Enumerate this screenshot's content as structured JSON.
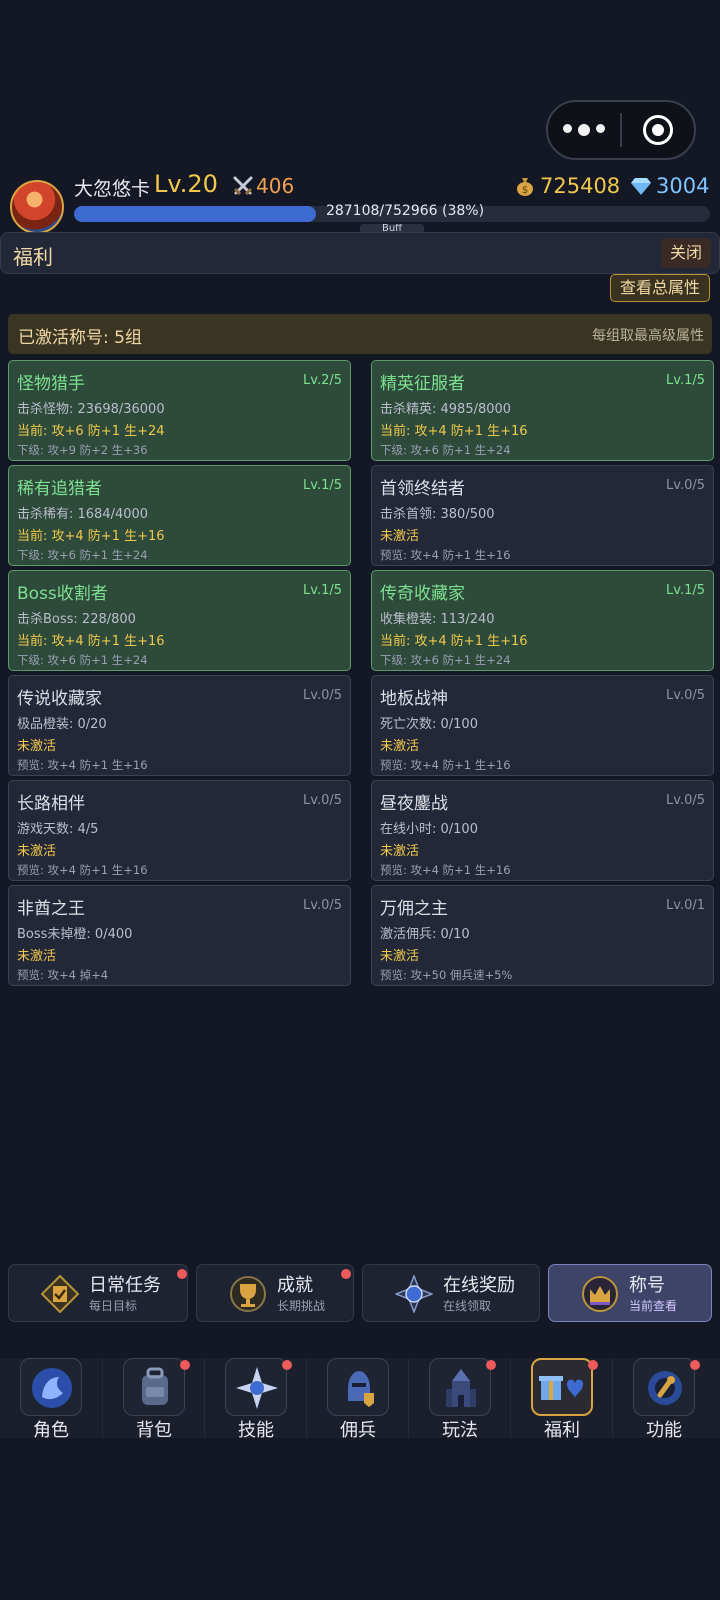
{
  "header": {
    "player_name": "大忽悠卡",
    "level": "Lv.20",
    "power": "406",
    "gold": "725408",
    "gems": "3004",
    "xp_text": "287108/752966 (38%)",
    "xp_progress": 0.38,
    "buff_label": "Buff"
  },
  "panel": {
    "title": "福利",
    "close_label": "关闭",
    "total_attr_label": "查看总属性",
    "summary_left": "已激活称号: 5组",
    "summary_right": "每组取最高级属性"
  },
  "titles": [
    {
      "name": "怪物猎手",
      "level": "Lv.2/5",
      "progress": "击杀怪物: 23698/36000",
      "current": "当前: 攻+6 防+1 生+24",
      "next": "下级: 攻+9 防+2 生+36",
      "active": true
    },
    {
      "name": "精英征服者",
      "level": "Lv.1/5",
      "progress": "击杀精英: 4985/8000",
      "current": "当前: 攻+4 防+1 生+16",
      "next": "下级: 攻+6 防+1 生+24",
      "active": true
    },
    {
      "name": "稀有追猎者",
      "level": "Lv.1/5",
      "progress": "击杀稀有: 1684/4000",
      "current": "当前: 攻+4 防+1 生+16",
      "next": "下级: 攻+6 防+1 生+24",
      "active": true
    },
    {
      "name": "首领终结者",
      "level": "Lv.0/5",
      "progress": "击杀首领: 380/500",
      "current": "未激活",
      "next": "预览: 攻+4 防+1 生+16",
      "active": false
    },
    {
      "name": "Boss收割者",
      "level": "Lv.1/5",
      "progress": "击杀Boss: 228/800",
      "current": "当前: 攻+4 防+1 生+16",
      "next": "下级: 攻+6 防+1 生+24",
      "active": true
    },
    {
      "name": "传奇收藏家",
      "level": "Lv.1/5",
      "progress": "收集橙装: 113/240",
      "current": "当前: 攻+4 防+1 生+16",
      "next": "下级: 攻+6 防+1 生+24",
      "active": true
    },
    {
      "name": "传说收藏家",
      "level": "Lv.0/5",
      "progress": "极品橙装: 0/20",
      "current": "未激活",
      "next": "预览: 攻+4 防+1 生+16",
      "active": false
    },
    {
      "name": "地板战神",
      "level": "Lv.0/5",
      "progress": "死亡次数: 0/100",
      "current": "未激活",
      "next": "预览: 攻+4 防+1 生+16",
      "active": false
    },
    {
      "name": "长路相伴",
      "level": "Lv.0/5",
      "progress": "游戏天数: 4/5",
      "current": "未激活",
      "next": "预览: 攻+4 防+1 生+16",
      "active": false
    },
    {
      "name": "昼夜鏖战",
      "level": "Lv.0/5",
      "progress": "在线小时: 0/100",
      "current": "未激活",
      "next": "预览: 攻+4 防+1 生+16",
      "active": false
    },
    {
      "name": "非酋之王",
      "level": "Lv.0/5",
      "progress": "Boss未掉橙: 0/400",
      "current": "未激活",
      "next": "预览: 攻+4 掉+4",
      "active": false
    },
    {
      "name": "万佣之主",
      "level": "Lv.0/1",
      "progress": "激活佣兵: 0/10",
      "current": "未激活",
      "next": "预览: 攻+50 佣兵速+5%",
      "active": false
    }
  ],
  "subtabs": [
    {
      "label": "日常任务",
      "sub": "每日目标",
      "icon": "daily-task-icon"
    },
    {
      "label": "成就",
      "sub": "长期挑战",
      "icon": "trophy-icon"
    },
    {
      "label": "在线奖励",
      "sub": "在线领取",
      "icon": "online-reward-icon"
    },
    {
      "label": "称号",
      "sub": "当前查看",
      "icon": "crown-icon"
    }
  ],
  "nav": [
    {
      "label": "角色",
      "icon": "character-icon"
    },
    {
      "label": "背包",
      "icon": "backpack-icon"
    },
    {
      "label": "技能",
      "icon": "skill-icon"
    },
    {
      "label": "佣兵",
      "icon": "mercenary-icon"
    },
    {
      "label": "玩法",
      "icon": "gameplay-icon"
    },
    {
      "label": "福利",
      "icon": "gift-icon"
    },
    {
      "label": "功能",
      "icon": "tool-icon"
    }
  ],
  "colors": {
    "accent_gold": "#f1c84b",
    "active_green": "#7de08f",
    "xp_blue": "#3d6bd1",
    "badge_red": "#ef5a5a"
  }
}
